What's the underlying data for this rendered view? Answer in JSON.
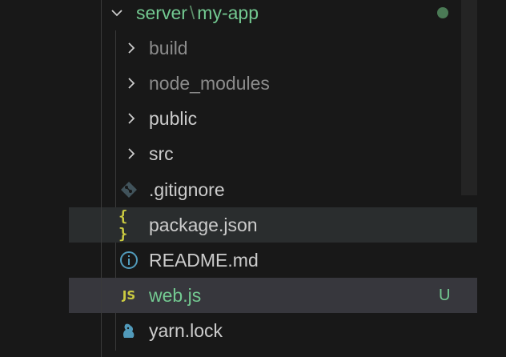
{
  "explorer": {
    "root": {
      "parent": "server",
      "separator": "\\",
      "name": "my-app"
    },
    "items": [
      {
        "label": "build",
        "type": "folder",
        "icon": "chevron-right-icon"
      },
      {
        "label": "node_modules",
        "type": "folder",
        "icon": "chevron-right-icon"
      },
      {
        "label": "public",
        "type": "folder",
        "icon": "chevron-right-icon"
      },
      {
        "label": "src",
        "type": "folder",
        "icon": "chevron-right-icon"
      },
      {
        "label": ".gitignore",
        "type": "file",
        "icon": "git-icon"
      },
      {
        "label": "package.json",
        "type": "file",
        "icon": "json-icon",
        "icon_text": "{ }"
      },
      {
        "label": "README.md",
        "type": "file",
        "icon": "info-icon"
      },
      {
        "label": "web.js",
        "type": "file",
        "icon": "js-icon",
        "icon_text": "JS",
        "git_status": "U"
      },
      {
        "label": "yarn.lock",
        "type": "file",
        "icon": "yarn-icon"
      }
    ]
  },
  "colors": {
    "background": "#181818",
    "hover_row": "#2a2d2e",
    "selected_row": "#37373d",
    "text": "#cccccc",
    "text_dim": "#8c8c8c",
    "git_untracked": "#73c991",
    "json_js_icon": "#cbcb41",
    "info_icon": "#519aba"
  }
}
